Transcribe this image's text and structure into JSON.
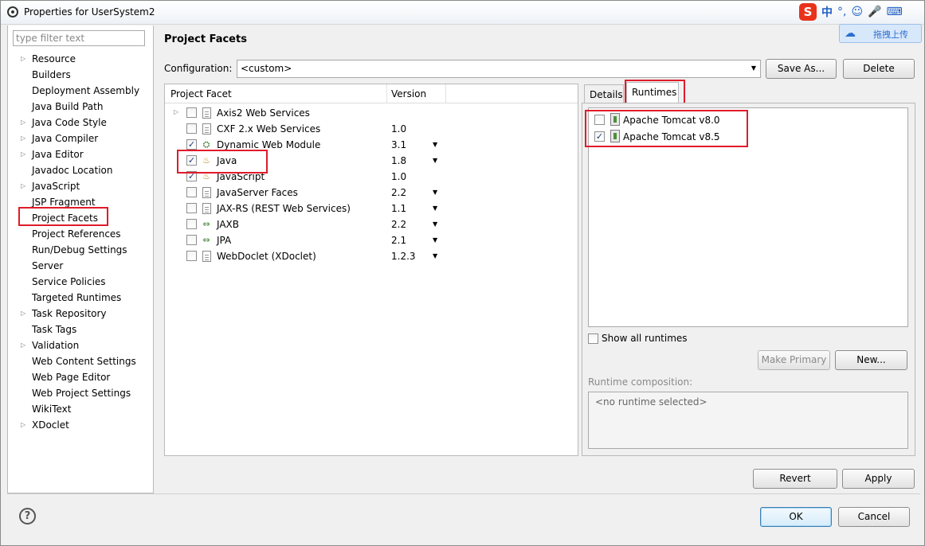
{
  "window": {
    "title": "Properties for UserSystem2"
  },
  "ime": {
    "logo": "S",
    "lang": "中",
    "punct": "°,",
    "glyphs": [
      "☺",
      "🎤",
      "⌨"
    ]
  },
  "baidu": {
    "label": "拖拽上传"
  },
  "nav": {
    "filter_placeholder": "type filter text",
    "items": [
      {
        "label": "Resource",
        "expandable": true
      },
      {
        "label": "Builders",
        "expandable": false
      },
      {
        "label": "Deployment Assembly",
        "expandable": false
      },
      {
        "label": "Java Build Path",
        "expandable": false
      },
      {
        "label": "Java Code Style",
        "expandable": true
      },
      {
        "label": "Java Compiler",
        "expandable": true
      },
      {
        "label": "Java Editor",
        "expandable": true
      },
      {
        "label": "Javadoc Location",
        "expandable": false
      },
      {
        "label": "JavaScript",
        "expandable": true
      },
      {
        "label": "JSP Fragment",
        "expandable": false
      },
      {
        "label": "Project Facets",
        "expandable": false,
        "selected": true
      },
      {
        "label": "Project References",
        "expandable": false
      },
      {
        "label": "Run/Debug Settings",
        "expandable": false
      },
      {
        "label": "Server",
        "expandable": false
      },
      {
        "label": "Service Policies",
        "expandable": false
      },
      {
        "label": "Targeted Runtimes",
        "expandable": false
      },
      {
        "label": "Task Repository",
        "expandable": true
      },
      {
        "label": "Task Tags",
        "expandable": false
      },
      {
        "label": "Validation",
        "expandable": true
      },
      {
        "label": "Web Content Settings",
        "expandable": false
      },
      {
        "label": "Web Page Editor",
        "expandable": false
      },
      {
        "label": "Web Project Settings",
        "expandable": false
      },
      {
        "label": "WikiText",
        "expandable": false
      },
      {
        "label": "XDoclet",
        "expandable": true
      }
    ]
  },
  "page": {
    "title": "Project Facets",
    "config_label": "Configuration:",
    "config_value": "<custom>",
    "save_as": "Save As...",
    "delete": "Delete"
  },
  "facets": {
    "col_facet": "Project Facet",
    "col_version": "Version",
    "rows": [
      {
        "name": "Axis2 Web Services",
        "version": "",
        "checked": false,
        "expandable": true,
        "dropdown": false,
        "icon": "page"
      },
      {
        "name": "CXF 2.x Web Services",
        "version": "1.0",
        "checked": false,
        "dropdown": false,
        "icon": "page"
      },
      {
        "name": "Dynamic Web Module",
        "version": "3.1",
        "checked": true,
        "dropdown": true,
        "icon": "web"
      },
      {
        "name": "Java",
        "version": "1.8",
        "checked": true,
        "dropdown": true,
        "icon": "java"
      },
      {
        "name": "JavaScript",
        "version": "1.0",
        "checked": true,
        "dropdown": false,
        "icon": "java"
      },
      {
        "name": "JavaServer Faces",
        "version": "2.2",
        "checked": false,
        "dropdown": true,
        "icon": "page"
      },
      {
        "name": "JAX-RS (REST Web Services)",
        "version": "1.1",
        "checked": false,
        "dropdown": true,
        "icon": "page"
      },
      {
        "name": "JAXB",
        "version": "2.2",
        "checked": false,
        "dropdown": true,
        "icon": "arrows"
      },
      {
        "name": "JPA",
        "version": "2.1",
        "checked": false,
        "dropdown": true,
        "icon": "arrows"
      },
      {
        "name": "WebDoclet (XDoclet)",
        "version": "1.2.3",
        "checked": false,
        "dropdown": true,
        "icon": "page"
      }
    ]
  },
  "tabs": {
    "details": "Details",
    "runtimes": "Runtimes"
  },
  "runtimes": {
    "items": [
      {
        "name": "Apache Tomcat v8.0",
        "checked": false
      },
      {
        "name": "Apache Tomcat v8.5",
        "checked": true
      }
    ],
    "show_all": "Show all runtimes",
    "make_primary": "Make Primary",
    "new": "New...",
    "composition_label": "Runtime composition:",
    "composition_value": "<no runtime selected>"
  },
  "buttons": {
    "revert": "Revert",
    "apply": "Apply",
    "ok": "OK",
    "cancel": "Cancel",
    "help": "?"
  },
  "colors": {
    "highlight_box": "#e01b2a",
    "ok_border": "#3c7fb1"
  }
}
